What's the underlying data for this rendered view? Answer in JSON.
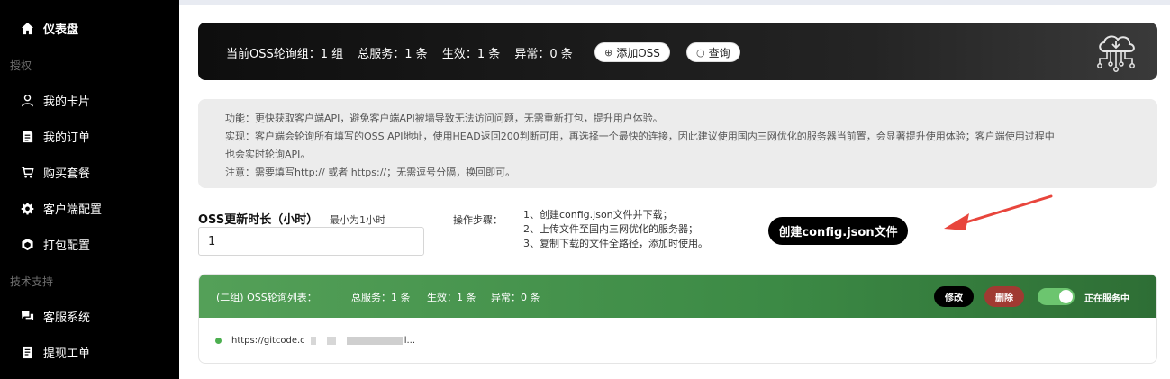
{
  "sidebar": {
    "items": [
      {
        "label": "仪表盘",
        "icon": "home-icon"
      },
      {
        "label": "我的卡片",
        "icon": "user-icon"
      },
      {
        "label": "我的订单",
        "icon": "document-icon"
      },
      {
        "label": "购买套餐",
        "icon": "cart-icon"
      },
      {
        "label": "客户端配置",
        "icon": "gear-icon"
      },
      {
        "label": "打包配置",
        "icon": "package-icon"
      },
      {
        "label": "客服系统",
        "icon": "chat-icon"
      },
      {
        "label": "提现工单",
        "icon": "ticket-icon"
      }
    ],
    "groups": [
      "授权",
      "技术支持"
    ]
  },
  "hero": {
    "groups_label": "当前OSS轮询组：1 组",
    "total_label": "总服务：1 条",
    "active_label": "生效：1 条",
    "error_label": "异常：0 条",
    "add_button": "添加OSS",
    "query_button": "查询",
    "icon": "cloud-network-icon"
  },
  "info": {
    "lines": [
      "功能：更快获取客户端API，避免客户端API被墙导致无法访问问题，无需重新打包，提升用户体验。",
      "实现：客户端会轮询所有填写的OSS API地址，使用HEAD返回200判断可用，再选择一个最快的连接，因此建议使用国内三网优化的服务器当前置，会显著提升使用体验；客户端使用过程中",
      "也会实时轮询API。",
      "注意：需要填写http:// 或者 https://；无需逗号分隔，换回即可。"
    ]
  },
  "duration": {
    "label": "OSS更新时长（小时）",
    "hint": "最小为1小时",
    "value": "1"
  },
  "steps": {
    "label": "操作步骤：",
    "items": [
      "1、创建config.json文件并下载；",
      "2、上传文件至国内三网优化的服务器；",
      "3、复制下载的文件全路径，添加时使用。"
    ]
  },
  "create_button": "创建config.json文件",
  "group": {
    "title": "(二组) OSS轮询列表：",
    "total": "总服务：1 条",
    "active": "生效：1 条",
    "error": "异常：0 条",
    "edit_button": "修改",
    "delete_button": "删除",
    "toggle_label": "正在服务中",
    "toggle_on": true,
    "url_prefix": "https://gitcode.c",
    "url_suffix": "l..."
  },
  "colors": {
    "sidebar_bg": "#000000",
    "accent_green": "#3c8a45",
    "danger": "#a03a32",
    "arrow": "#e8453c"
  }
}
